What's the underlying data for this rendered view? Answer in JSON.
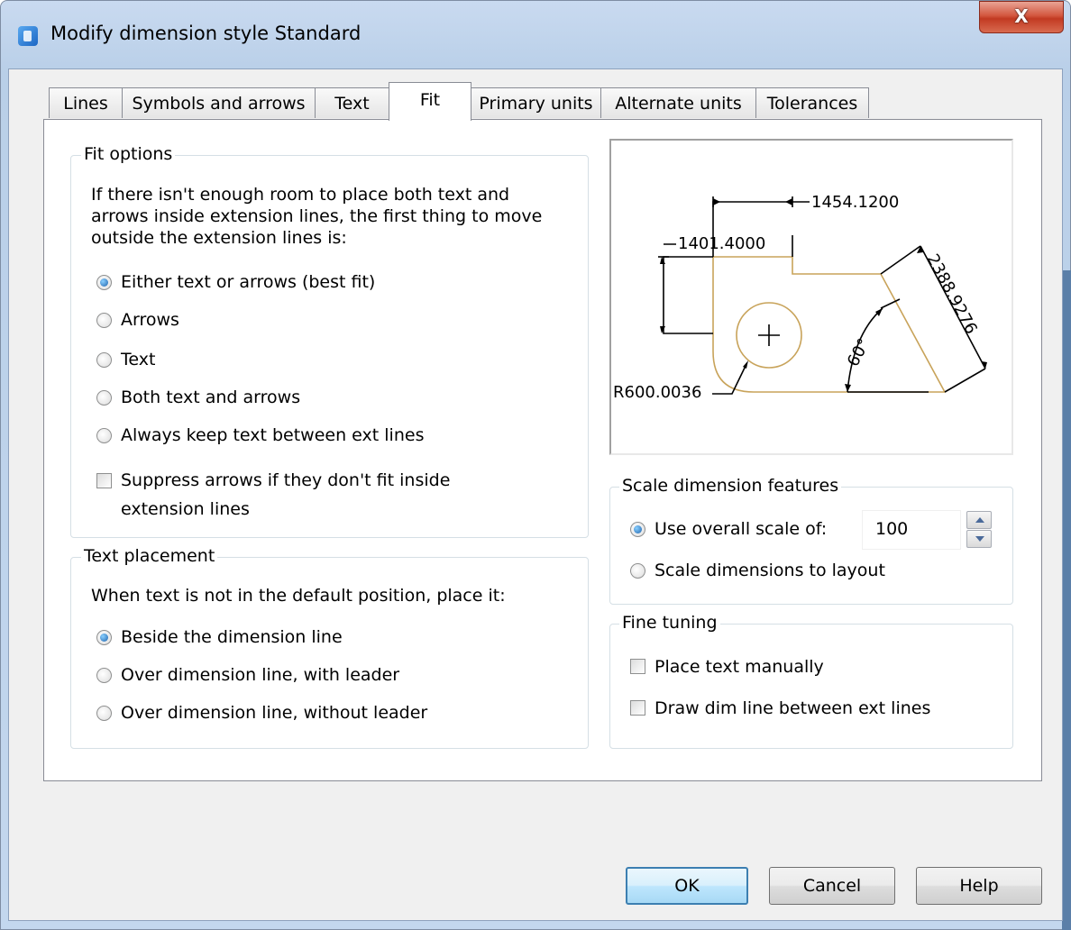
{
  "window": {
    "title": "Modify dimension style Standard",
    "close_glyph": "X"
  },
  "tabs": [
    {
      "label": "Lines"
    },
    {
      "label": "Symbols and arrows"
    },
    {
      "label": "Text"
    },
    {
      "label": "Fit",
      "active": true
    },
    {
      "label": "Primary units"
    },
    {
      "label": "Alternate units"
    },
    {
      "label": "Tolerances"
    }
  ],
  "fit_options": {
    "label": "Fit options",
    "description_lines": [
      "If there isn't enough room to place both text and",
      "arrows inside extension lines, the first thing to move",
      "outside the extension lines is:"
    ],
    "options": [
      {
        "label": "Either text or arrows (best fit)",
        "selected": true
      },
      {
        "label": "Arrows",
        "selected": false
      },
      {
        "label": "Text",
        "selected": false
      },
      {
        "label": "Both text and arrows",
        "selected": false
      },
      {
        "label": "Always keep text between ext lines",
        "selected": false
      }
    ],
    "suppress_checkbox": {
      "label_lines": [
        "Suppress arrows if they don't fit inside",
        "extension lines"
      ],
      "checked": false
    }
  },
  "text_placement": {
    "label": "Text placement",
    "description": "When text is not in the default position, place it:",
    "options": [
      {
        "label": "Beside the dimension line",
        "selected": true
      },
      {
        "label": "Over dimension line, with leader",
        "selected": false
      },
      {
        "label": "Over dimension line, without leader",
        "selected": false
      }
    ]
  },
  "preview": {
    "dims": {
      "top": "1454.1200",
      "left": "1401.4000",
      "slant": "2388.9276",
      "angle": "60°",
      "radius": "R600.0036"
    },
    "colors": {
      "geometry": "#c8a35a",
      "dimension": "#000000"
    }
  },
  "scale_features": {
    "label": "Scale dimension features",
    "options": [
      {
        "label": "Use overall scale of:",
        "selected": true
      },
      {
        "label": "Scale dimensions to layout",
        "selected": false
      }
    ],
    "scale_value": "100"
  },
  "fine_tuning": {
    "label": "Fine tuning",
    "checkboxes": [
      {
        "label": "Place text manually",
        "checked": false
      },
      {
        "label": "Draw dim line between ext lines",
        "checked": false
      }
    ]
  },
  "buttons": {
    "ok": "OK",
    "cancel": "Cancel",
    "help": "Help"
  }
}
